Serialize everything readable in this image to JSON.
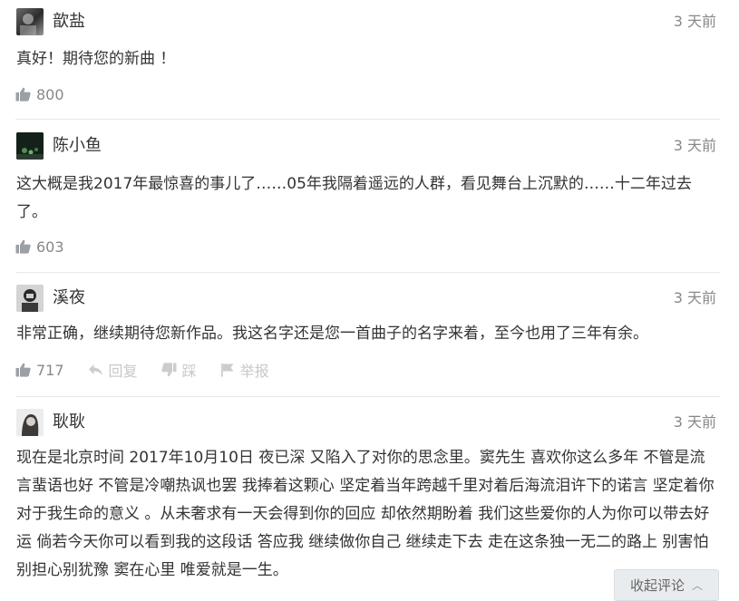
{
  "comments": [
    {
      "username": "歆盐",
      "time": "3 天前",
      "text": "真好！期待您的新曲 ！",
      "likes": "800"
    },
    {
      "username": "陈小鱼",
      "time": "3 天前",
      "text": "这大概是我2017年最惊喜的事儿了……05年我隔着遥远的人群，看见舞台上沉默的……十二年过去了。",
      "likes": "603"
    },
    {
      "username": "溪夜",
      "time": "3 天前",
      "text": "非常正确，继续期待您新作品。我这名字还是您一首曲子的名字来着，至今也用了三年有余。",
      "likes": "717",
      "reply_label": "回复",
      "dislike_label": "踩",
      "report_label": "举报"
    },
    {
      "username": "耿耿",
      "time": "3 天前",
      "text": "现在是北京时间 2017年10月10日 夜已深 又陷入了对你的思念里。窦先生 喜欢你这么多年 不管是流言蜚语也好 不管是冷嘲热讽也罢 我捧着这颗心 坚定着当年跨越千里对着后海流泪许下的诺言 坚定着你对于我生命的意义 。从未奢求有一天会得到你的回应 却依然期盼着 我们这些爱你的人为你可以带去好运 倘若今天你可以看到我的这段话 答应我 继续做你自己 继续走下去 走在这条独一无二的路上 别害怕别担心别犹豫 窦在心里 唯爱就是一生。"
    }
  ],
  "collapse_button": {
    "label": "收起评论",
    "arrow": "︿"
  },
  "icons": {
    "like": "thumbs-up-icon",
    "reply": "reply-arrow-icon",
    "dislike": "thumbs-down-icon",
    "report": "flag-icon"
  }
}
